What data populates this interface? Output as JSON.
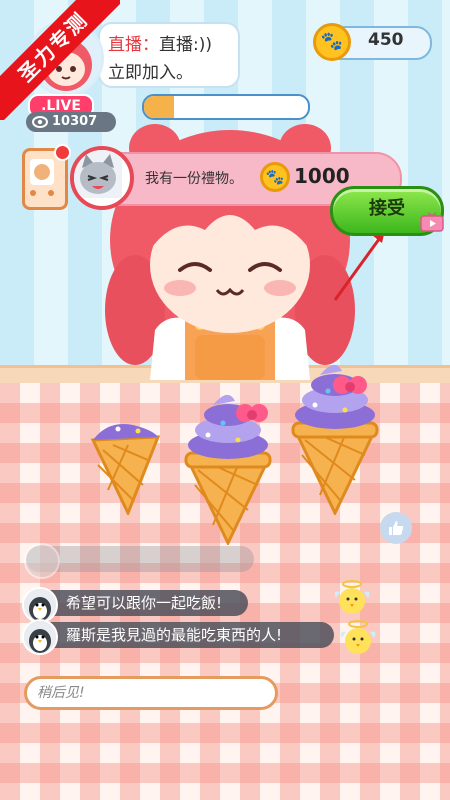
{
  "corner_ribbon": {
    "label": "圣力专测"
  },
  "streamer": {
    "title_prefix": "直播：",
    "title_rest": "直播:))",
    "subtitle": "立即加入。",
    "live_label": ".LIVE",
    "viewer_count": "10307",
    "progress_fraction": 0.18
  },
  "wallet": {
    "coins": "450",
    "coin_icon": "paw-coin-icon"
  },
  "gift": {
    "message": "我有一份禮物。",
    "amount": "1000",
    "accept_label": "接受"
  },
  "chat": {
    "messages": [
      {
        "text": "希望可以跟你一起吃飯!"
      },
      {
        "text": "羅斯是我見過的最能吃東西的人!"
      }
    ],
    "input_placeholder": "稍后见!"
  },
  "colors": {
    "accent_red": "#e8141c",
    "accept_green": "#3cb71d",
    "gift_bar_pink": "#f7b8c8",
    "coin_gold": "#ffc21f"
  }
}
